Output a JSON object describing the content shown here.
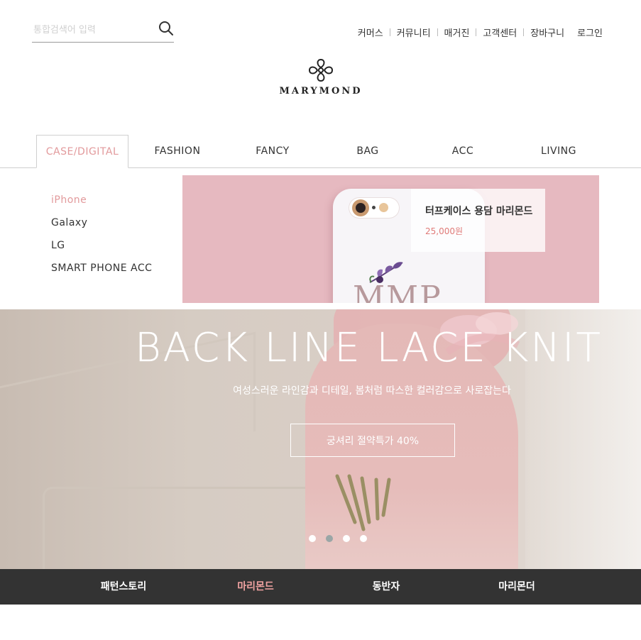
{
  "search": {
    "placeholder": "통합검색어 입력",
    "icon": "search-icon"
  },
  "util_nav": {
    "items": [
      "커머스",
      "커뮤니티",
      "매거진",
      "고객센터",
      "장바구니"
    ],
    "login": "로그인"
  },
  "logo": {
    "wordmark": "MARYMOND",
    "icon": "marymond-flower-icon"
  },
  "categories": [
    "CASE/DIGITAL",
    "FASHION",
    "FANCY",
    "BAG",
    "ACC",
    "LIVING"
  ],
  "active_category": "CASE/DIGITAL",
  "submenu": [
    "iPhone",
    "Galaxy",
    "LG",
    "SMART PHONE ACC"
  ],
  "active_submenu": "iPhone",
  "promo": {
    "title": "터프케이스 용담 마리몬드",
    "price": "25,000원",
    "product_mark": "MMP"
  },
  "hero": {
    "headline": "BACK LINE LACE KNIT",
    "subline": "여성스러운 라인감과 디테일, 봄처럼 따스한 컬러감으로 사로잡는다",
    "cta": "궁셔리 절약특가 40%",
    "slide_count": 4,
    "active_slide": 2
  },
  "bottom_tabs": [
    "패턴스토리",
    "마리몬드",
    "동반자",
    "마리몬더"
  ],
  "active_bottom_tab": "마리몬드",
  "colors": {
    "accent": "#e29a9c",
    "bar": "#333333",
    "promo_bg": "#e6b9c0",
    "price": "#e07a78"
  }
}
